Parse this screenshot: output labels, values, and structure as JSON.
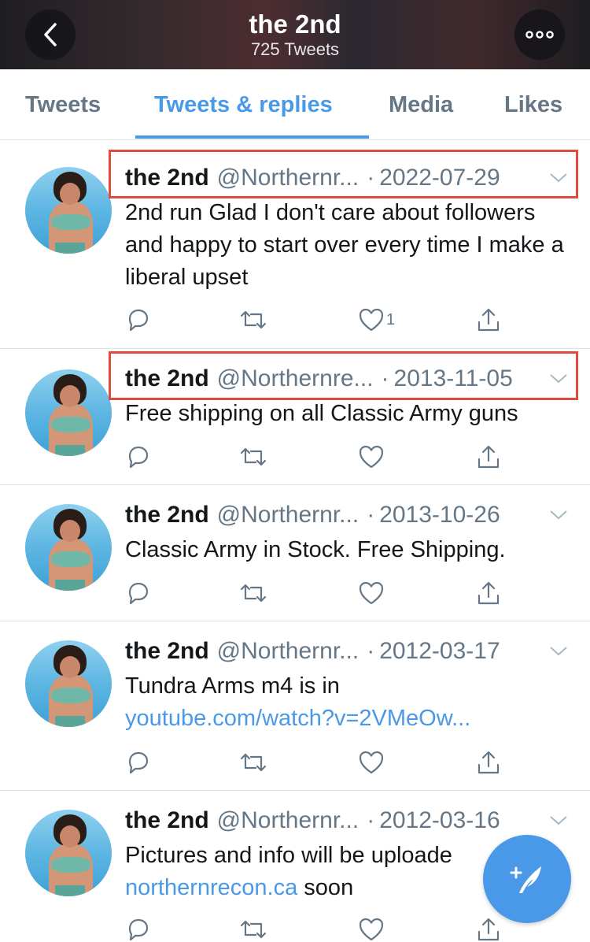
{
  "header": {
    "title": "the 2nd",
    "subtitle": "725 Tweets",
    "back_icon": "chevron-left-icon",
    "more_icon": "more-horizontal-icon"
  },
  "tabs": [
    {
      "label": "Tweets",
      "active": false
    },
    {
      "label": "Tweets & replies",
      "active": true
    },
    {
      "label": "Media",
      "active": false
    },
    {
      "label": "Likes",
      "active": false
    }
  ],
  "colors": {
    "accent": "#4a99e9",
    "secondary_text": "#657786",
    "highlight_box": "#e04a3f"
  },
  "tweets": [
    {
      "name": "the 2nd",
      "handle": "@Northernr...",
      "dot": "·",
      "date": "2022-07-29",
      "text": "2nd run  Glad I don't care about followers and happy to start over every time I make a liberal upset",
      "like_count": "1"
    },
    {
      "name": "the 2nd",
      "handle": "@Northernre...",
      "dot": "·",
      "date": "2013-11-05",
      "text": "Free shipping on all Classic Army guns",
      "like_count": ""
    },
    {
      "name": "the 2nd",
      "handle": "@Northernr...",
      "dot": "·",
      "date": "2013-10-26",
      "text": "Classic Army in Stock.  Free Shipping.",
      "like_count": ""
    },
    {
      "name": "the 2nd",
      "handle": "@Northernr...",
      "dot": "·",
      "date": "2012-03-17",
      "text": "Tundra Arms m4 is in",
      "link": "youtube.com/watch?v=2VMeOw...",
      "like_count": ""
    },
    {
      "name": "the 2nd",
      "handle": "@Northernr...",
      "dot": "·",
      "date": "2012-03-16",
      "text": "Pictures and info will be uploade",
      "link": "northernrecon.ca",
      "text_after_link": " soon",
      "like_count": ""
    }
  ],
  "fab": {
    "icon": "compose-tweet-icon"
  }
}
